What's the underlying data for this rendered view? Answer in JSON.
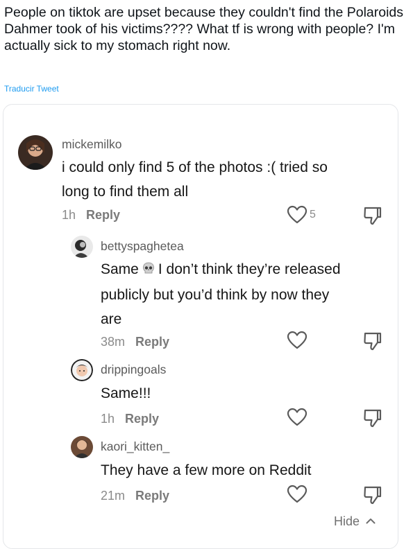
{
  "tweet": {
    "text": "People on tiktok are upset because they couldn't find the Polaroids Dahmer took of his victims???? What tf is wrong with people? I'm actually sick to my stomach right now.",
    "translate_label": "Traducir Tweet"
  },
  "comment": {
    "username": "mickemilko",
    "text": "i could only find 5 of the photos :( tried so long to find them all",
    "time": "1h",
    "reply_label": "Reply",
    "likes": "5"
  },
  "replies": [
    {
      "username": "bettyspaghetea",
      "text_before": "Same",
      "emoji": "skull",
      "text_after": "I don’t think they’re released publicly but you’d think by now they are",
      "time": "38m",
      "reply_label": "Reply"
    },
    {
      "username": "drippingoals",
      "text": "Same!!!",
      "time": "1h",
      "reply_label": "Reply"
    },
    {
      "username": "kaori_kitten_",
      "text": "They have a few more on Reddit",
      "time": "21m",
      "reply_label": "Reply"
    }
  ],
  "hide_label": "Hide",
  "icons": {
    "like": "heart-outline-icon",
    "dislike": "thumbs-down-icon",
    "hide": "chevron-up-icon"
  },
  "colors": {
    "link": "#1d9bf0",
    "muted": "#8a8a8a",
    "icon": "#5a5a5a"
  }
}
